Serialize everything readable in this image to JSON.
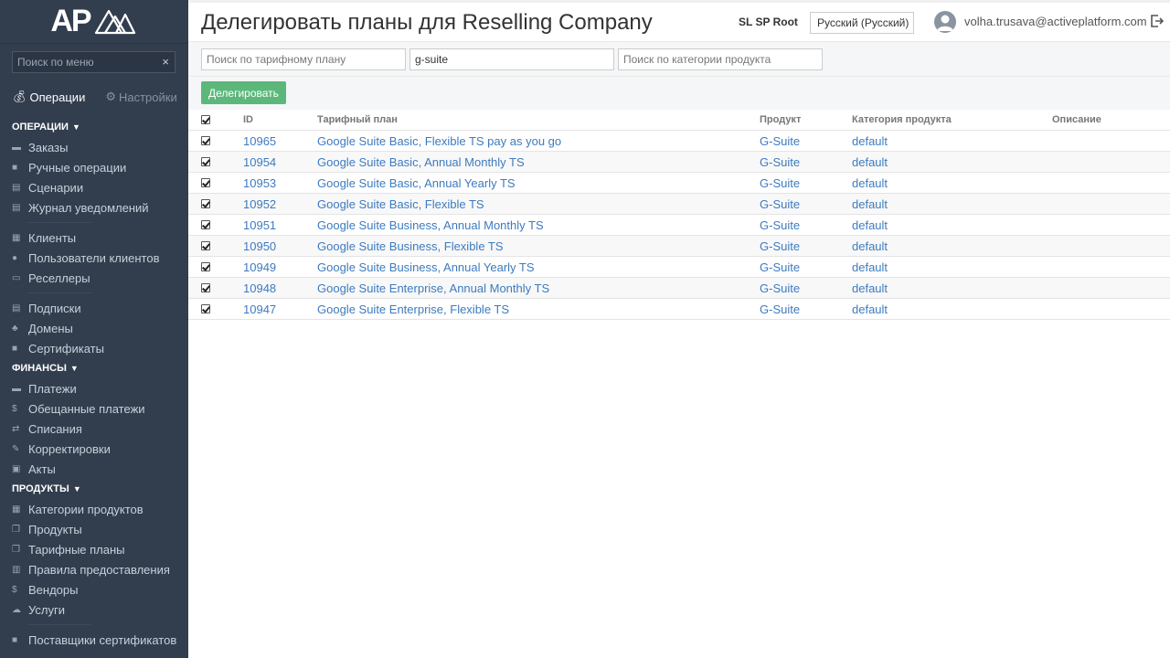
{
  "logo": {
    "text": "AP"
  },
  "sidebar": {
    "search_placeholder": "Поиск по меню",
    "search_clear": "×",
    "tabs": [
      {
        "label": "Операции",
        "icon": "money-bag-icon",
        "active": true
      },
      {
        "label": "Настройки",
        "icon": "gear-icon",
        "active": false
      }
    ],
    "sections": {
      "operations": "ОПЕРАЦИИ",
      "finance": "ФИНАНСЫ",
      "products": "ПРОДУКТЫ"
    },
    "items": {
      "orders": "Заказы",
      "manual_ops": "Ручные операции",
      "scenarios": "Сценарии",
      "notifications": "Журнал уведомлений",
      "clients": "Клиенты",
      "client_users": "Пользователи клиентов",
      "resellers": "Реселлеры",
      "subscriptions": "Подписки",
      "domains": "Домены",
      "certificates": "Сертификаты",
      "payments": "Платежи",
      "promised_payments": "Обещанные платежи",
      "writeoffs": "Списания",
      "adjustments": "Корректировки",
      "acts": "Акты",
      "product_categories": "Категории продуктов",
      "products": "Продукты",
      "plans": "Тарифные планы",
      "provision_rules": "Правила предоставления",
      "vendors": "Вендоры",
      "services": "Услуги",
      "cert_providers": "Поставщики сертификатов"
    }
  },
  "header": {
    "title": "Делегировать планы для Reselling Company",
    "account": "SL SP Root",
    "language": "Русский (Русский)",
    "user_email": "volha.trusava@activeplatform.com"
  },
  "filters": {
    "plan_placeholder": "Поиск по тарифному плану",
    "plan_value": "",
    "product_placeholder": "",
    "product_value": "g-suite",
    "category_placeholder": "Поиск по категории продукта",
    "category_value": ""
  },
  "actions": {
    "delegate": "Делегировать"
  },
  "table": {
    "columns": {
      "id": "ID",
      "plan": "Тарифный план",
      "product": "Продукт",
      "category": "Категория продукта",
      "description": "Описание"
    },
    "rows": [
      {
        "id": "10965",
        "plan": "Google Suite Basic, Flexible TS pay as you go",
        "product": "G-Suite",
        "category": "default",
        "description": ""
      },
      {
        "id": "10954",
        "plan": "Google Suite Basic, Annual Monthly TS",
        "product": "G-Suite",
        "category": "default",
        "description": ""
      },
      {
        "id": "10953",
        "plan": "Google Suite Basic, Annual Yearly TS",
        "product": "G-Suite",
        "category": "default",
        "description": ""
      },
      {
        "id": "10952",
        "plan": "Google Suite Basic, Flexible TS",
        "product": "G-Suite",
        "category": "default",
        "description": ""
      },
      {
        "id": "10951",
        "plan": "Google Suite Business, Annual Monthly TS",
        "product": "G-Suite",
        "category": "default",
        "description": ""
      },
      {
        "id": "10950",
        "plan": "Google Suite Business, Flexible TS",
        "product": "G-Suite",
        "category": "default",
        "description": ""
      },
      {
        "id": "10949",
        "plan": "Google Suite Business, Annual Yearly TS",
        "product": "G-Suite",
        "category": "default",
        "description": ""
      },
      {
        "id": "10948",
        "plan": "Google Suite Enterprise, Annual Monthly TS",
        "product": "G-Suite",
        "category": "default",
        "description": ""
      },
      {
        "id": "10947",
        "plan": "Google Suite Enterprise, Flexible TS",
        "product": "G-Suite",
        "category": "default",
        "description": ""
      }
    ]
  },
  "colors": {
    "sidebar_bg": "#323e4e",
    "link": "#3d7bbf",
    "delegate_button": "#5cb87a"
  }
}
